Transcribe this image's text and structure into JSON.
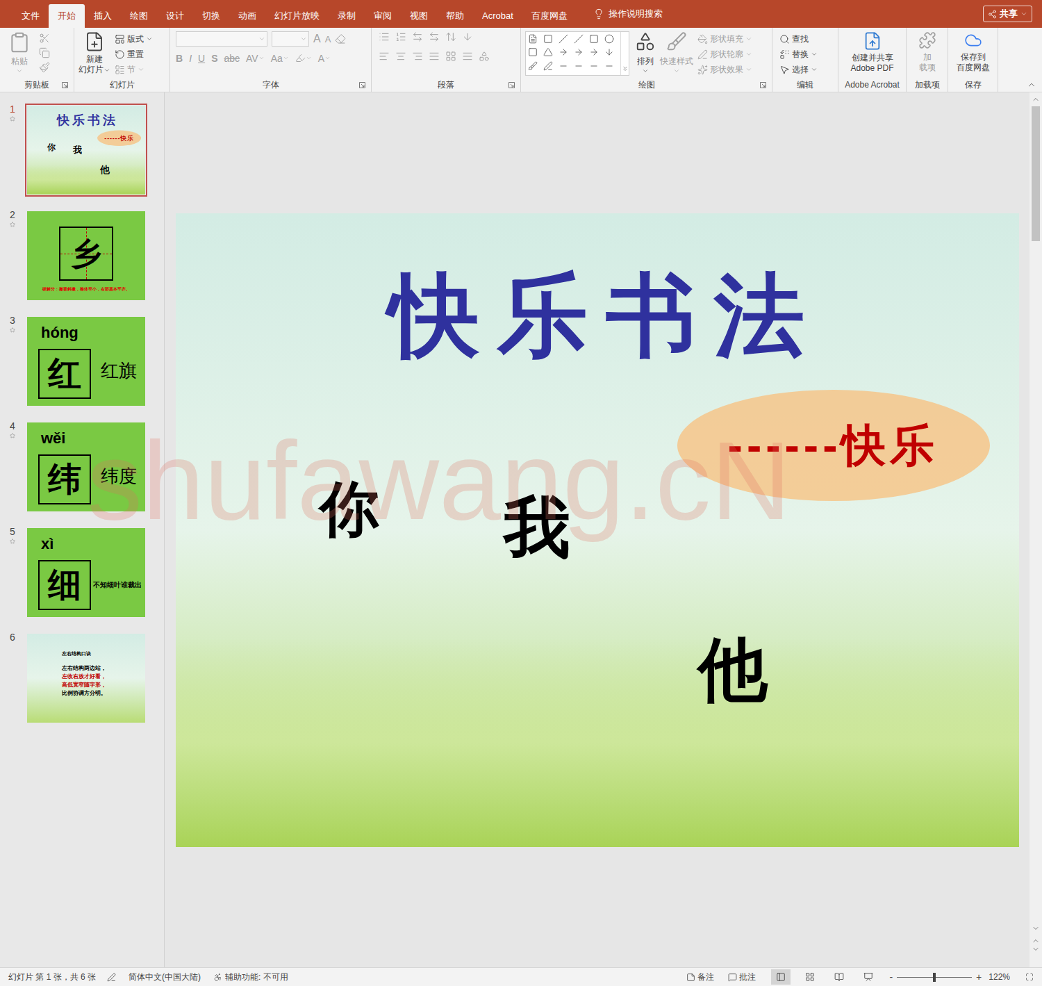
{
  "ribbon_tabs": [
    {
      "label": "文件",
      "selected": false
    },
    {
      "label": "开始",
      "selected": true
    },
    {
      "label": "插入",
      "selected": false
    },
    {
      "label": "绘图",
      "selected": false
    },
    {
      "label": "设计",
      "selected": false
    },
    {
      "label": "切换",
      "selected": false
    },
    {
      "label": "动画",
      "selected": false
    },
    {
      "label": "幻灯片放映",
      "selected": false
    },
    {
      "label": "录制",
      "selected": false
    },
    {
      "label": "审阅",
      "selected": false
    },
    {
      "label": "视图",
      "selected": false
    },
    {
      "label": "帮助",
      "selected": false
    },
    {
      "label": "Acrobat",
      "selected": false
    },
    {
      "label": "百度网盘",
      "selected": false
    }
  ],
  "tell_me": "操作说明搜索",
  "share_button": "共享",
  "ribbon": {
    "clipboard": {
      "name": "剪贴板",
      "paste": "粘贴",
      "disabled": true
    },
    "slides": {
      "name": "幻灯片",
      "new_slide": [
        "新建",
        "幻灯片"
      ],
      "layout": "版式",
      "reset": "重置",
      "section": "节",
      "section_disabled": true
    },
    "font": {
      "name": "字体",
      "disabled": true,
      "grow": "A",
      "shrink": "A",
      "styles": [
        {
          "label": "B",
          "kind": "bold"
        },
        {
          "label": "I",
          "kind": "italic"
        },
        {
          "label": "U",
          "kind": "underline"
        },
        {
          "label": "S",
          "kind": "shadow"
        },
        {
          "label": "abc",
          "kind": "strike"
        },
        {
          "label": "AV",
          "kind": "spacing"
        },
        {
          "label": "Aa",
          "kind": "case"
        }
      ],
      "color": "A"
    },
    "paragraph": {
      "name": "段落",
      "disabled": true
    },
    "drawing": {
      "name": "绘图",
      "arrange": "排列",
      "quick_styles": "快速样式",
      "quick_styles_disabled": true,
      "shape_options": [
        {
          "label": "形状填充",
          "disabled": true
        },
        {
          "label": "形状轮廓",
          "disabled": true
        },
        {
          "label": "形状效果",
          "disabled": true
        }
      ]
    },
    "editing": {
      "name": "编辑",
      "items": [
        {
          "label": "查找",
          "dropdown": false
        },
        {
          "label": "替换",
          "dropdown": true
        },
        {
          "label": "选择",
          "dropdown": true
        }
      ]
    },
    "acrobat": {
      "name": "Adobe Acrobat",
      "button": [
        "创建并共享",
        "Adobe PDF"
      ]
    },
    "addins": {
      "name": "加载项",
      "button": [
        "加",
        "载项"
      ],
      "disabled": true
    },
    "save": {
      "name": "保存",
      "button": [
        "保存到",
        "百度网盘"
      ]
    }
  },
  "thumbnails": [
    {
      "number": "1",
      "selected": true,
      "animated": true,
      "kind": "title"
    },
    {
      "number": "2",
      "selected": false,
      "animated": true,
      "kind": "grid",
      "char": "乡",
      "caption": "破解分：撇要斜撇，整体窄小，右部基本平齐。"
    },
    {
      "number": "3",
      "selected": false,
      "animated": true,
      "kind": "char",
      "pinyin": "hóng",
      "char": "红",
      "word": "红旗"
    },
    {
      "number": "4",
      "selected": false,
      "animated": true,
      "kind": "char",
      "pinyin": "wěi",
      "char": "纬",
      "word": "纬度"
    },
    {
      "number": "5",
      "selected": false,
      "animated": true,
      "kind": "phrase",
      "pinyin": "xì",
      "char": "细",
      "word": "不知细叶谁裁出"
    },
    {
      "number": "6",
      "selected": false,
      "animated": false,
      "kind": "verse",
      "title": "左右结构口诀",
      "lines": [
        {
          "text": "左右结构两边站，",
          "color": "#000000"
        },
        {
          "text": "左收右放才好看，",
          "color": "#c00000"
        },
        {
          "text": "高低宽窄随字形，",
          "color": "#c00000"
        },
        {
          "text": "比例协调方分明。",
          "color": "#000000"
        }
      ]
    }
  ],
  "slide": {
    "title": "快乐书法",
    "tagline": "------快乐",
    "chars": [
      "你",
      "我",
      "他"
    ]
  },
  "watermark": "shufawang.cN",
  "status_bar": {
    "slide_info": "幻灯片 第 1 张，共 6 张",
    "language": "简体中文(中国大陆)",
    "accessibility": "辅助功能: 不可用",
    "notes": "备注",
    "comments": "批注",
    "views": [
      {
        "kind": "normal",
        "selected": true
      },
      {
        "kind": "sorter",
        "selected": false
      },
      {
        "kind": "reading",
        "selected": false
      },
      {
        "kind": "slideshow",
        "selected": false
      }
    ],
    "zoom_out": "-",
    "zoom_in": "+",
    "zoom": "122%",
    "zoom_level": 0.5
  }
}
